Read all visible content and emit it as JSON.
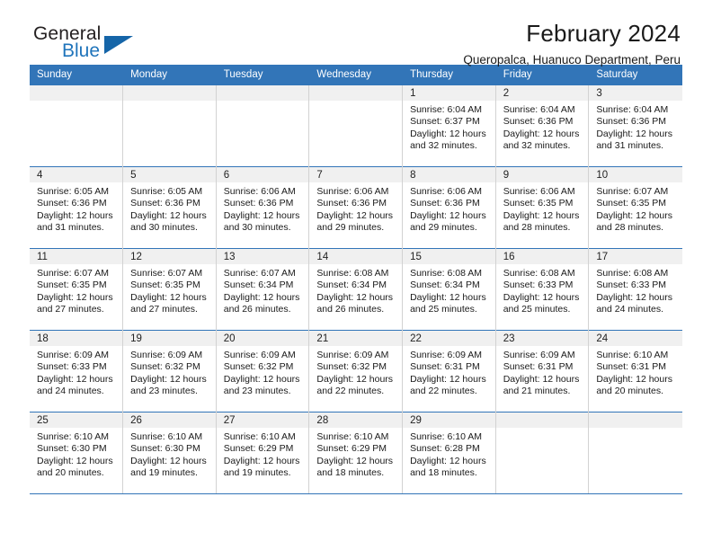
{
  "brand": {
    "name_top": "General",
    "name_bottom": "Blue",
    "accent_color": "#1f74bb",
    "triangle_color": "#1565a8"
  },
  "header": {
    "title": "February 2024",
    "subtitle": "Queropalca, Huanuco Department, Peru",
    "header_bg": "#3275b8",
    "daynum_bg": "#f0f0f0"
  },
  "weekdays": [
    "Sunday",
    "Monday",
    "Tuesday",
    "Wednesday",
    "Thursday",
    "Friday",
    "Saturday"
  ],
  "labels": {
    "sunrise_prefix": "Sunrise:",
    "sunset_prefix": "Sunset:",
    "daylight_prefix": "Daylight:"
  },
  "weeks": [
    [
      {
        "day": "",
        "empty": true
      },
      {
        "day": "",
        "empty": true
      },
      {
        "day": "",
        "empty": true
      },
      {
        "day": "",
        "empty": true
      },
      {
        "day": "1",
        "sunrise": "Sunrise: 6:04 AM",
        "sunset": "Sunset: 6:37 PM",
        "daylight1": "Daylight: 12 hours",
        "daylight2": "and 32 minutes."
      },
      {
        "day": "2",
        "sunrise": "Sunrise: 6:04 AM",
        "sunset": "Sunset: 6:36 PM",
        "daylight1": "Daylight: 12 hours",
        "daylight2": "and 32 minutes."
      },
      {
        "day": "3",
        "sunrise": "Sunrise: 6:04 AM",
        "sunset": "Sunset: 6:36 PM",
        "daylight1": "Daylight: 12 hours",
        "daylight2": "and 31 minutes."
      }
    ],
    [
      {
        "day": "4",
        "sunrise": "Sunrise: 6:05 AM",
        "sunset": "Sunset: 6:36 PM",
        "daylight1": "Daylight: 12 hours",
        "daylight2": "and 31 minutes."
      },
      {
        "day": "5",
        "sunrise": "Sunrise: 6:05 AM",
        "sunset": "Sunset: 6:36 PM",
        "daylight1": "Daylight: 12 hours",
        "daylight2": "and 30 minutes."
      },
      {
        "day": "6",
        "sunrise": "Sunrise: 6:06 AM",
        "sunset": "Sunset: 6:36 PM",
        "daylight1": "Daylight: 12 hours",
        "daylight2": "and 30 minutes."
      },
      {
        "day": "7",
        "sunrise": "Sunrise: 6:06 AM",
        "sunset": "Sunset: 6:36 PM",
        "daylight1": "Daylight: 12 hours",
        "daylight2": "and 29 minutes."
      },
      {
        "day": "8",
        "sunrise": "Sunrise: 6:06 AM",
        "sunset": "Sunset: 6:36 PM",
        "daylight1": "Daylight: 12 hours",
        "daylight2": "and 29 minutes."
      },
      {
        "day": "9",
        "sunrise": "Sunrise: 6:06 AM",
        "sunset": "Sunset: 6:35 PM",
        "daylight1": "Daylight: 12 hours",
        "daylight2": "and 28 minutes."
      },
      {
        "day": "10",
        "sunrise": "Sunrise: 6:07 AM",
        "sunset": "Sunset: 6:35 PM",
        "daylight1": "Daylight: 12 hours",
        "daylight2": "and 28 minutes."
      }
    ],
    [
      {
        "day": "11",
        "sunrise": "Sunrise: 6:07 AM",
        "sunset": "Sunset: 6:35 PM",
        "daylight1": "Daylight: 12 hours",
        "daylight2": "and 27 minutes."
      },
      {
        "day": "12",
        "sunrise": "Sunrise: 6:07 AM",
        "sunset": "Sunset: 6:35 PM",
        "daylight1": "Daylight: 12 hours",
        "daylight2": "and 27 minutes."
      },
      {
        "day": "13",
        "sunrise": "Sunrise: 6:07 AM",
        "sunset": "Sunset: 6:34 PM",
        "daylight1": "Daylight: 12 hours",
        "daylight2": "and 26 minutes."
      },
      {
        "day": "14",
        "sunrise": "Sunrise: 6:08 AM",
        "sunset": "Sunset: 6:34 PM",
        "daylight1": "Daylight: 12 hours",
        "daylight2": "and 26 minutes."
      },
      {
        "day": "15",
        "sunrise": "Sunrise: 6:08 AM",
        "sunset": "Sunset: 6:34 PM",
        "daylight1": "Daylight: 12 hours",
        "daylight2": "and 25 minutes."
      },
      {
        "day": "16",
        "sunrise": "Sunrise: 6:08 AM",
        "sunset": "Sunset: 6:33 PM",
        "daylight1": "Daylight: 12 hours",
        "daylight2": "and 25 minutes."
      },
      {
        "day": "17",
        "sunrise": "Sunrise: 6:08 AM",
        "sunset": "Sunset: 6:33 PM",
        "daylight1": "Daylight: 12 hours",
        "daylight2": "and 24 minutes."
      }
    ],
    [
      {
        "day": "18",
        "sunrise": "Sunrise: 6:09 AM",
        "sunset": "Sunset: 6:33 PM",
        "daylight1": "Daylight: 12 hours",
        "daylight2": "and 24 minutes."
      },
      {
        "day": "19",
        "sunrise": "Sunrise: 6:09 AM",
        "sunset": "Sunset: 6:32 PM",
        "daylight1": "Daylight: 12 hours",
        "daylight2": "and 23 minutes."
      },
      {
        "day": "20",
        "sunrise": "Sunrise: 6:09 AM",
        "sunset": "Sunset: 6:32 PM",
        "daylight1": "Daylight: 12 hours",
        "daylight2": "and 23 minutes."
      },
      {
        "day": "21",
        "sunrise": "Sunrise: 6:09 AM",
        "sunset": "Sunset: 6:32 PM",
        "daylight1": "Daylight: 12 hours",
        "daylight2": "and 22 minutes."
      },
      {
        "day": "22",
        "sunrise": "Sunrise: 6:09 AM",
        "sunset": "Sunset: 6:31 PM",
        "daylight1": "Daylight: 12 hours",
        "daylight2": "and 22 minutes."
      },
      {
        "day": "23",
        "sunrise": "Sunrise: 6:09 AM",
        "sunset": "Sunset: 6:31 PM",
        "daylight1": "Daylight: 12 hours",
        "daylight2": "and 21 minutes."
      },
      {
        "day": "24",
        "sunrise": "Sunrise: 6:10 AM",
        "sunset": "Sunset: 6:31 PM",
        "daylight1": "Daylight: 12 hours",
        "daylight2": "and 20 minutes."
      }
    ],
    [
      {
        "day": "25",
        "sunrise": "Sunrise: 6:10 AM",
        "sunset": "Sunset: 6:30 PM",
        "daylight1": "Daylight: 12 hours",
        "daylight2": "and 20 minutes."
      },
      {
        "day": "26",
        "sunrise": "Sunrise: 6:10 AM",
        "sunset": "Sunset: 6:30 PM",
        "daylight1": "Daylight: 12 hours",
        "daylight2": "and 19 minutes."
      },
      {
        "day": "27",
        "sunrise": "Sunrise: 6:10 AM",
        "sunset": "Sunset: 6:29 PM",
        "daylight1": "Daylight: 12 hours",
        "daylight2": "and 19 minutes."
      },
      {
        "day": "28",
        "sunrise": "Sunrise: 6:10 AM",
        "sunset": "Sunset: 6:29 PM",
        "daylight1": "Daylight: 12 hours",
        "daylight2": "and 18 minutes."
      },
      {
        "day": "29",
        "sunrise": "Sunrise: 6:10 AM",
        "sunset": "Sunset: 6:28 PM",
        "daylight1": "Daylight: 12 hours",
        "daylight2": "and 18 minutes."
      },
      {
        "day": "",
        "empty": true
      },
      {
        "day": "",
        "empty": true
      }
    ]
  ]
}
